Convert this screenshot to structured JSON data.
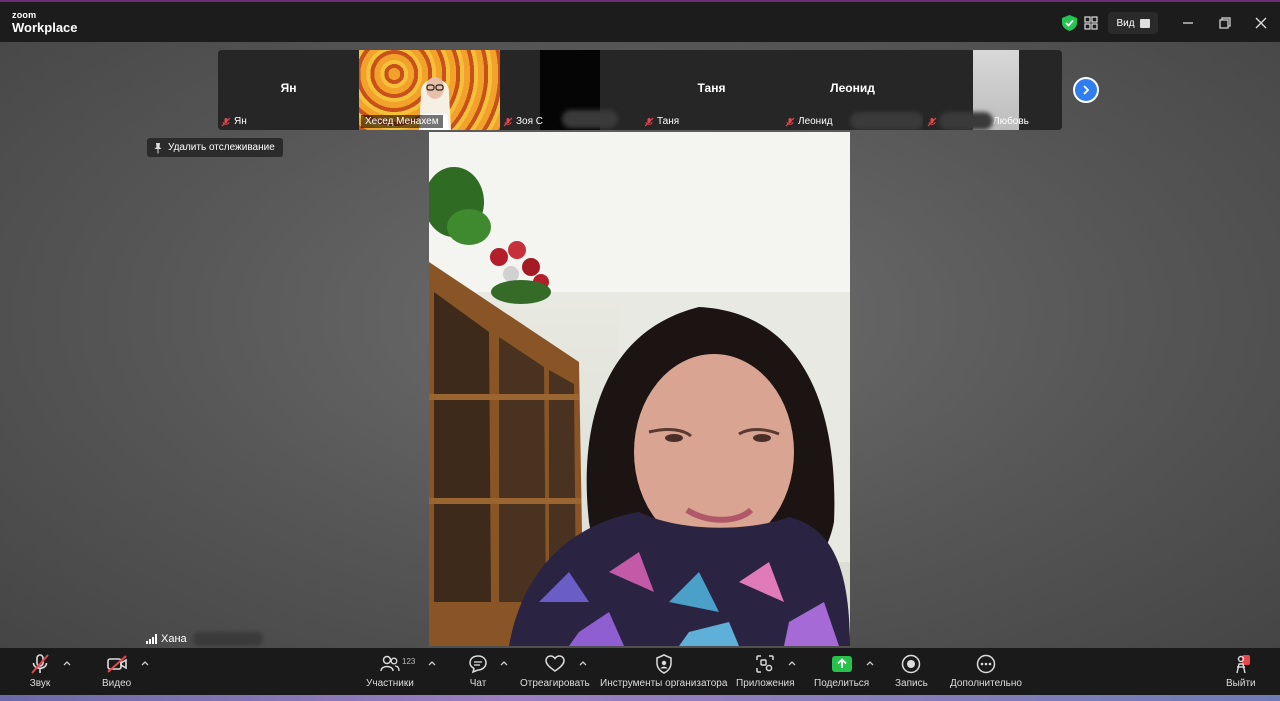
{
  "app": {
    "logo_top": "zoom",
    "logo_main": "Workplace",
    "view_label": "Вид"
  },
  "filmstrip": {
    "tiles": [
      {
        "big_name": "Ян",
        "label": "Ян"
      },
      {
        "label": "Хесед Менахем"
      },
      {
        "label": "Зоя С"
      },
      {
        "big_name": "Таня",
        "label": "Таня"
      },
      {
        "big_name": "Леонид",
        "label": "Леонид"
      },
      {
        "label": "Любовь"
      }
    ]
  },
  "unpin_label": "Удалить отслеживание",
  "active_speaker": {
    "name": "Хана"
  },
  "toolbar": {
    "audio": "Звук",
    "video": "Видео",
    "participants": "Участники",
    "participants_count": "123",
    "chat": "Чат",
    "react": "Отреагировать",
    "host_tools": "Инструменты организатора",
    "apps": "Приложения",
    "share": "Поделиться",
    "record": "Запись",
    "more": "Дополнительно",
    "leave": "Выйти"
  },
  "colors": {
    "accent_blue": "#2e7ef0",
    "share_green": "#27c24c",
    "muted_red": "#e5484d",
    "shield_green": "#23c552"
  }
}
